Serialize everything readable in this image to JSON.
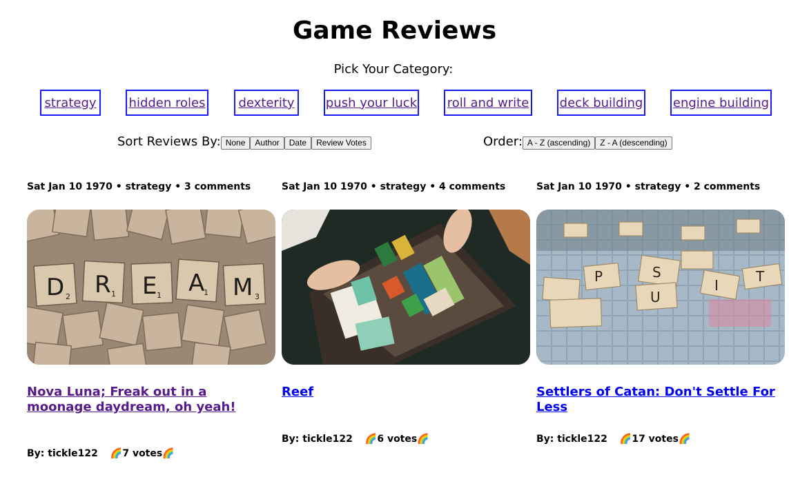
{
  "page": {
    "title": "Game Reviews"
  },
  "categories": {
    "label": "Pick Your Category:",
    "items": [
      "strategy",
      "hidden roles",
      "dexterity",
      "push your luck",
      "roll and write",
      "deck building",
      "engine building"
    ]
  },
  "sort": {
    "label": "Sort Reviews By:",
    "options": [
      "None",
      "Author",
      "Date",
      "Review Votes"
    ]
  },
  "order": {
    "label": "Order:",
    "options": [
      "A - Z (ascending)",
      "Z - A (descending)"
    ]
  },
  "reviews": [
    {
      "meta": "Sat Jan 10 1970 • strategy • 3 comments",
      "title": "Nova Luna; Freak out in a moonage daydream, oh yeah!",
      "author": "By: tickle122",
      "votes": "🌈7 votes🌈",
      "image": "scrabble-tiles-dream"
    },
    {
      "meta": "Sat Jan 10 1970 • strategy • 4 comments",
      "title": "Reef",
      "author": "By: tickle122",
      "votes": "🌈6 votes🌈",
      "image": "board-game-box-components"
    },
    {
      "meta": "Sat Jan 10 1970 • strategy • 2 comments",
      "title": "Settlers of Catan: Don't Settle For Less",
      "author": "By: tickle122",
      "votes": "🌈17 votes🌈",
      "image": "scrabble-board-tiles"
    }
  ],
  "colors": {
    "link_visited": "#551a8b",
    "link": "#0000ee",
    "category_border": "#1a1aff"
  }
}
